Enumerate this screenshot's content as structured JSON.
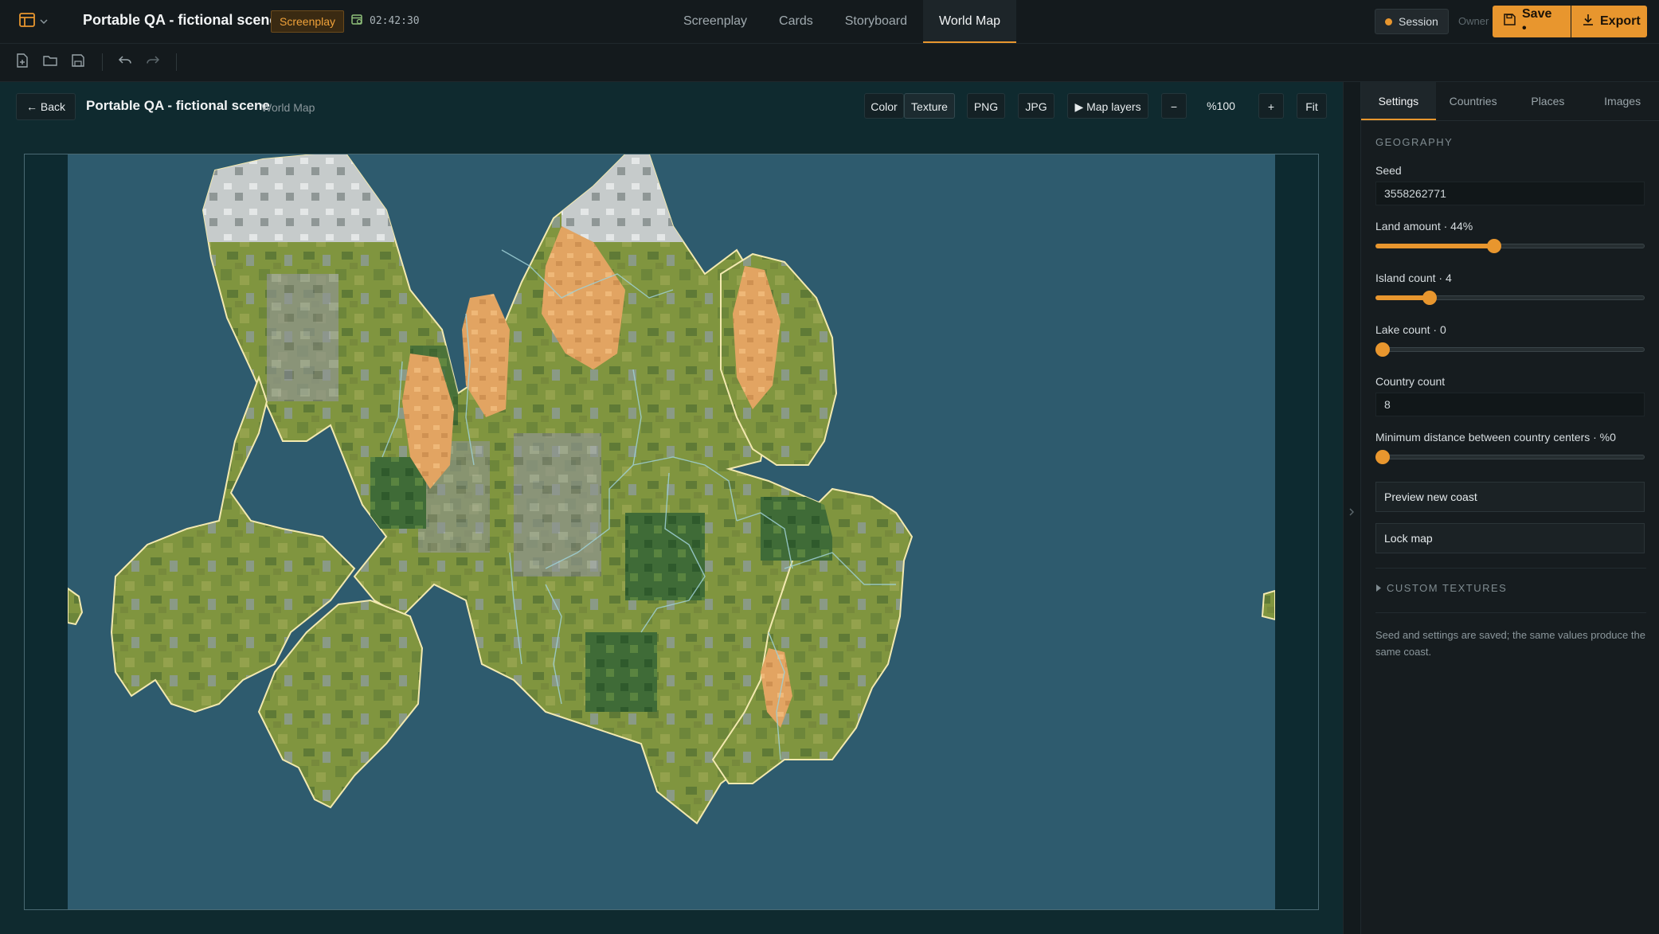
{
  "app": {
    "document_title": "Portable QA - fictional scene",
    "mode_badge": "Screenplay",
    "timer": "02:42:30"
  },
  "nav_tabs": [
    {
      "label": "Screenplay",
      "active": false
    },
    {
      "label": "Cards",
      "active": false
    },
    {
      "label": "Storyboard",
      "active": false
    },
    {
      "label": "World Map",
      "active": true
    }
  ],
  "header_right": {
    "session_label": "Session",
    "owner_label": "Owner",
    "save_label": "Save •",
    "export_label": "Export"
  },
  "toolbar_icons": [
    "new-file-icon",
    "open-folder-icon",
    "save-disk-icon",
    "undo-icon",
    "redo-icon"
  ],
  "workspace": {
    "back_label": "← Back",
    "title": "Portable QA - fictional scene",
    "subtitle": "World Map",
    "color_label": "Color",
    "texture_label": "Texture",
    "png_label": "PNG",
    "jpg_label": "JPG",
    "layers_label": "▶ Map layers",
    "zoom_out_label": "−",
    "zoom_level": "%100",
    "zoom_in_label": "+",
    "fit_label": "Fit"
  },
  "panel": {
    "tabs": [
      {
        "label": "Settings",
        "active": true
      },
      {
        "label": "Countries",
        "active": false
      },
      {
        "label": "Places",
        "active": false
      },
      {
        "label": "Images",
        "active": false
      }
    ],
    "section_title": "GEOGRAPHY",
    "seed_label": "Seed",
    "seed_value": "3558262771",
    "land_label": "Land amount · 44%",
    "land_value": 0.44,
    "island_label": "Island count · 4",
    "island_value": 0.2,
    "lake_label": "Lake count · 0",
    "lake_value": 0,
    "country_label": "Country count",
    "country_value": "8",
    "mindist_label": "Minimum distance between country centers · %0",
    "mindist_value": 0,
    "preview_label": "Preview new coast",
    "lock_label": "Lock map",
    "custom_textures_label": "CUSTOM TEXTURES",
    "note": "Seed and settings are saved; the same values produce the same coast."
  },
  "colors": {
    "accent": "#e8962e",
    "ocean": "#2e5b6e",
    "grass": "#7f9440",
    "forest": "#3f6b37",
    "desert": "#e0a060",
    "snow": "#c9cfd0",
    "coast": "#f3e9b0"
  }
}
